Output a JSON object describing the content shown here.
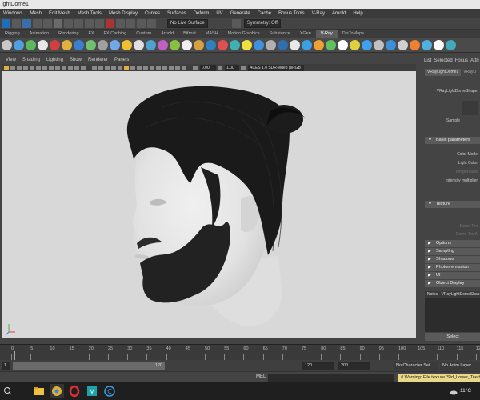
{
  "window": {
    "title": "ightDome1"
  },
  "menubar": [
    "Windows",
    "Mesh",
    "Edit Mesh",
    "Mesh Tools",
    "Mesh Display",
    "Curves",
    "Surfaces",
    "Deform",
    "UV",
    "Generate",
    "Cache",
    "Bonus Tools",
    "V-Ray",
    "Arnold",
    "Help"
  ],
  "statusline": {
    "live_surface": "No Live Surface",
    "symmetry": "Symmetry: Off"
  },
  "shelf_tabs": [
    {
      "label": "Rigging",
      "active": false
    },
    {
      "label": "Animation",
      "active": false
    },
    {
      "label": "Rendering",
      "active": false
    },
    {
      "label": "FX",
      "active": false
    },
    {
      "label": "FX Caching",
      "active": false
    },
    {
      "label": "Custom",
      "active": false
    },
    {
      "label": "Arnold",
      "active": false
    },
    {
      "label": "Bifrost",
      "active": false
    },
    {
      "label": "MASH",
      "active": false
    },
    {
      "label": "Motion Graphics",
      "active": false
    },
    {
      "label": "Substance",
      "active": false
    },
    {
      "label": "XGen",
      "active": false
    },
    {
      "label": "V-Ray",
      "active": true
    },
    {
      "label": "DisToMaps",
      "active": false
    }
  ],
  "shelf_icons": [
    "#c8c8c8",
    "#4fa0e0",
    "#5cb85c",
    "#e8e8e8",
    "#d04040",
    "#e0b040",
    "#3a80d0",
    "#6fc06f",
    "#a0a0a0",
    "#70a8e8",
    "#f0c030",
    "#e0e0e0",
    "#50a0d0",
    "#c060c0",
    "#88c040",
    "#f0f0f0",
    "#d8a040",
    "#3080c0",
    "#e05050",
    "#40b0b0",
    "#f0e040",
    "#4090e0",
    "#b0b0b0",
    "#2f6fb0",
    "#e8e8e8",
    "#3aa0e0",
    "#f0a030",
    "#60c060",
    "#ffffff",
    "#e0d040",
    "#40a0f0",
    "#c0c0c0",
    "#3d8fd8",
    "#d0d0d0",
    "#f08030",
    "#50b0e0",
    "#ffffff",
    "#4ab"
  ],
  "viewport": {
    "menu": [
      "View",
      "Shading",
      "Lighting",
      "Show",
      "Renderer",
      "Panels"
    ],
    "exposure": "0.00",
    "gamma": "1.00",
    "color_space": "ACES 1.0 SDR-video (sRGB"
  },
  "right_panel": {
    "tabs": [
      "List",
      "Selected",
      "Focus",
      "Attri"
    ],
    "node_tabs": [
      "VRayLightDome1",
      "VRayLi"
    ],
    "shape_label": "VRayLightDomeShape:",
    "sample_label": "Sample",
    "basic_parameters": "Basic parameters",
    "color_mode": "Color Mode",
    "light_color": "Light Color",
    "temperature": "Temperature",
    "intensity_multiplier": "Intensity multiplier",
    "texture": "Texture",
    "dome_tex": "Dome Tex",
    "dome_tex_a": "Dome Tex A",
    "sections": [
      "Options",
      "Sampling",
      "Shadows",
      "Photon emission",
      "UI",
      "Object Display"
    ],
    "notes_label": "Notes:",
    "notes_value": "VRayLightDomeShap",
    "select_button": "Select"
  },
  "timeslider": {
    "ticks": [
      "0",
      "5",
      "10",
      "15",
      "20",
      "25",
      "30",
      "35",
      "40",
      "45",
      "50",
      "55",
      "60",
      "65",
      "70",
      "75",
      "80",
      "85",
      "90",
      "95",
      "100",
      "105",
      "110",
      "115",
      "12"
    ]
  },
  "range": {
    "start": "1",
    "end": "120",
    "anim_end": "120",
    "total": "200",
    "character_set": "No Character Set",
    "anim_layer": "No Anim Layer"
  },
  "cmdline": {
    "mel_label": "MEL",
    "warning": "// Warning: File texture 'Std_Lower_Teeth"
  },
  "taskbar": {
    "temp": "11°C"
  }
}
